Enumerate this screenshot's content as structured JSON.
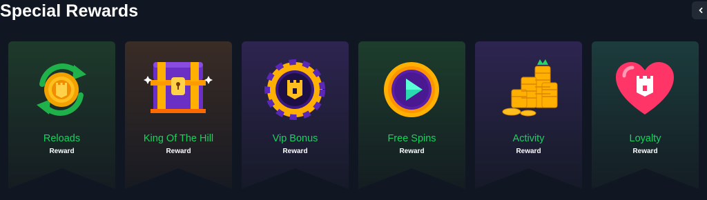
{
  "page": {
    "title": "Special Rewards"
  },
  "nav": {
    "prev_icon": "chevron-left-icon"
  },
  "cards": [
    {
      "name": "Reloads",
      "sub": "Reward",
      "icon": "reload-coin-icon",
      "bg_top": "#1e3a2b",
      "bg_bottom": "#151c22"
    },
    {
      "name": "King Of The Hill",
      "sub": "Reward",
      "icon": "treasure-chest-icon",
      "bg_top": "#3a2c26",
      "bg_bottom": "#171a22"
    },
    {
      "name": "Vip Bonus",
      "sub": "Reward",
      "icon": "vip-chip-icon",
      "bg_top": "#2e2450",
      "bg_bottom": "#161a28"
    },
    {
      "name": "Free Spins",
      "sub": "Reward",
      "icon": "play-coin-icon",
      "bg_top": "#1d3d2c",
      "bg_bottom": "#141d22"
    },
    {
      "name": "Activity",
      "sub": "Reward",
      "icon": "coin-stacks-icon",
      "bg_top": "#2d2550",
      "bg_bottom": "#161a28"
    },
    {
      "name": "Loyalty",
      "sub": "Reward",
      "icon": "heart-icon",
      "bg_top": "#1c3c3c",
      "bg_bottom": "#141d24"
    }
  ]
}
